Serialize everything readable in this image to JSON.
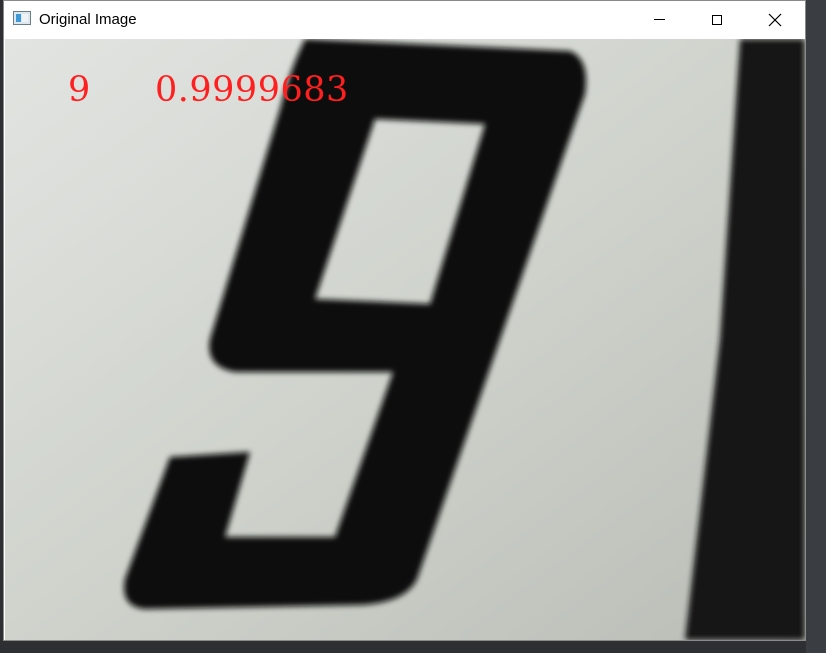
{
  "window": {
    "title": "Original Image",
    "icon": "app-window-icon",
    "controls": [
      "minimize-icon",
      "maximize-icon",
      "close-icon"
    ]
  },
  "overlay": {
    "predicted_label": "9",
    "confidence": "0.9999683",
    "text_color": "#ff1f1f"
  },
  "colors": {
    "paper": "#c8ccc6",
    "digit": "#0d0d0d",
    "background_dark": "#121212"
  }
}
